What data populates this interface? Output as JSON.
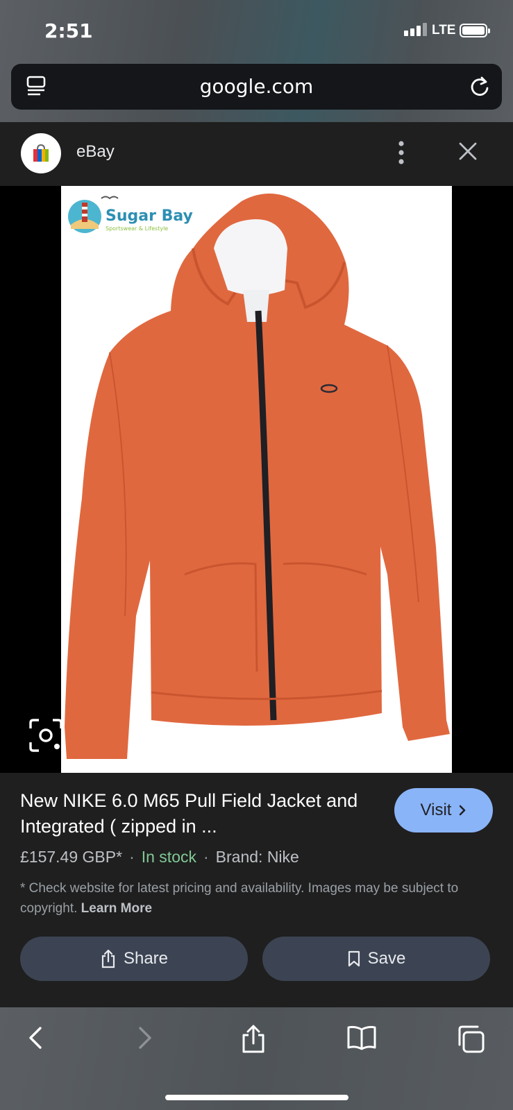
{
  "status_bar": {
    "time": "2:51",
    "network": "LTE"
  },
  "browser": {
    "url": "google.com"
  },
  "result_card": {
    "site_name": "eBay",
    "image": {
      "watermark_brand": "Sugar Bay",
      "watermark_tagline": "Sportswear & Lifestyle"
    },
    "title": "New NIKE 6.0 M65 Pull Field Jacket and Integrated ( zipped in ...",
    "visit_label": "Visit",
    "price": "£157.49 GBP*",
    "separator": "·",
    "availability": "In stock",
    "brand": "Brand: Nike",
    "disclaimer": "* Check website for latest pricing and availability. Images may be subject to copyright.",
    "learn_more": "Learn More",
    "share_label": "Share",
    "save_label": "Save"
  },
  "colors": {
    "accent_button": "#8ab4f8",
    "in_stock": "#81c995",
    "pill_bg": "#3c4453",
    "jacket": "#e0683f"
  },
  "icons": [
    "tabs-icon",
    "reload-icon",
    "more-vert-icon",
    "close-icon",
    "lens-icon",
    "chevron-right-icon",
    "share-icon",
    "bookmark-icon",
    "back-icon",
    "forward-icon",
    "book-icon",
    "tabs-overview-icon"
  ]
}
